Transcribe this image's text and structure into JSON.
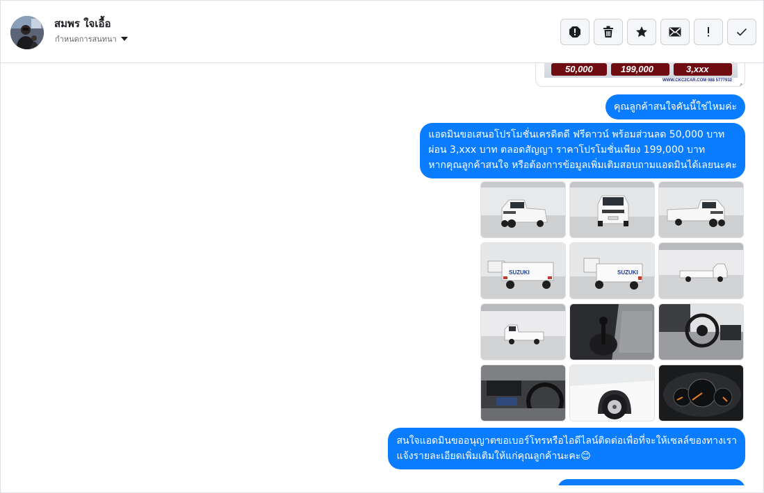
{
  "header": {
    "contact_name": "สมพร ใจเอื้อ",
    "conversation_label": "กำหนดการสนทนา"
  },
  "actions": [
    {
      "name": "spam-icon",
      "label": "spam"
    },
    {
      "name": "trash-icon",
      "label": "delete"
    },
    {
      "name": "star-icon",
      "label": "star"
    },
    {
      "name": "mail-icon",
      "label": "mark unread"
    },
    {
      "name": "exclamation-icon",
      "label": "important"
    },
    {
      "name": "check-icon",
      "label": "done"
    }
  ],
  "chat": {
    "banner": {
      "values": [
        "50,000",
        "199,000",
        "3,xxx"
      ],
      "url_text": "WWW.CKC2CAR.COM 088 5777932"
    },
    "messages": [
      "คุณลูกค้าสนใจคันนี้ใช่ไหมค่ะ",
      "แอดมินขอเสนอโปรโมชั่นเครดิตดี ฟรีดาวน์ พร้อมส่วนลด 50,000 บาท",
      "ผ่อน 3,xxx บาท ตลอดสัญญา ราคาโปรโมชั่นเพียง 199,000 บาท",
      "หากคุณลูกค้าสนใจ หรือต้องการข้อมูลเพิ่มเติมสอบถามแอดมินได้เลยนะคะ",
      "สนใจแอดมินขออนุญาตขอเบอร์โทรหรือไอดีไลน์ติดต่อเพื่อที่จะให้เซลล์ของทางเรา",
      "แจ้งรายละเอียดเพิ่มเติมให้แก่คุณลูกค้านะคะ😊"
    ],
    "photos": [
      {
        "name": "truck-front-left-photo"
      },
      {
        "name": "truck-front-photo"
      },
      {
        "name": "truck-front-right-photo"
      },
      {
        "name": "truck-rear-left-photo"
      },
      {
        "name": "truck-rear-right-photo"
      },
      {
        "name": "truck-side-right-photo"
      },
      {
        "name": "truck-side-left-photo"
      },
      {
        "name": "gear-shifter-photo"
      },
      {
        "name": "steering-wheel-photo"
      },
      {
        "name": "dashboard-photo"
      },
      {
        "name": "wheel-photo"
      },
      {
        "name": "gauge-cluster-photo"
      }
    ]
  },
  "colors": {
    "bubble": "#0a7cff",
    "banner_pill": "#6e0c12"
  }
}
